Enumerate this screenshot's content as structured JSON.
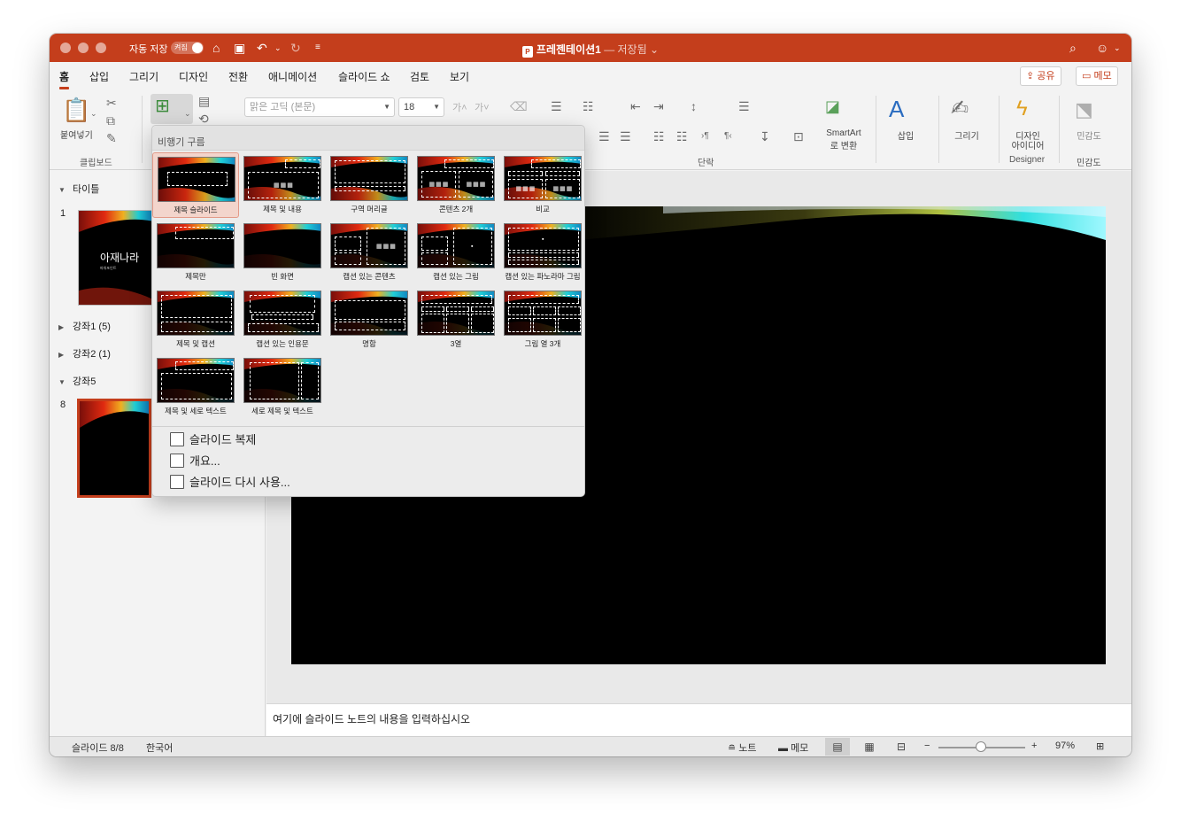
{
  "titlebar": {
    "autosave_label": "자동 저장",
    "autosave_state": "켜짐",
    "document_title": "프레젠테이션1",
    "save_status": "— 저장됨",
    "ppt_badge": "P"
  },
  "ribbon_tabs": [
    {
      "label": "홈",
      "active": true
    },
    {
      "label": "삽입"
    },
    {
      "label": "그리기"
    },
    {
      "label": "디자인"
    },
    {
      "label": "전환"
    },
    {
      "label": "애니메이션"
    },
    {
      "label": "슬라이드 쇼"
    },
    {
      "label": "검토"
    },
    {
      "label": "보기"
    }
  ],
  "share_button": "공유",
  "memo_button": "메모",
  "ribbon": {
    "paste_label": "붙여넣기",
    "clipboard_group": "클립보드",
    "font_name_placeholder": "맑은 고딕 (본문)",
    "font_size": "18",
    "paragraph_group": "단락",
    "smartart_label_1": "SmartArt",
    "smartart_label_2": "로 변환",
    "insert_label": "삽입",
    "draw_label": "그리기",
    "designer_label_1": "디자인",
    "designer_label_2": "아이디어",
    "designer_group": "Designer",
    "sensitivity_label": "민감도",
    "sensitivity_group": "민감도"
  },
  "layout_gallery": {
    "header": "비행기 구름",
    "layouts": [
      "제목 슬라이드",
      "제목 및 내용",
      "구역 머리글",
      "콘텐츠 2개",
      "비교",
      "제목만",
      "빈 화면",
      "캡션 있는 콘텐츠",
      "캡션 있는 그림",
      "캡션 있는 파노라마 그림",
      "제목 및 캡션",
      "캡션 있는 인용문",
      "명함",
      "3열",
      "그림 열 3개",
      "제목 및 세로 텍스트",
      "세로 제목 및 텍스트"
    ],
    "selected_index": 0,
    "commands": [
      "슬라이드 복제",
      "개요...",
      "슬라이드 다시 사용..."
    ]
  },
  "slide_pane": {
    "sections": [
      {
        "name": "타이틀",
        "expanded": true
      },
      {
        "name": "강좌1 (5)",
        "expanded": false
      },
      {
        "name": "강좌2 (1)",
        "expanded": false
      },
      {
        "name": "강좌5",
        "expanded": true
      }
    ],
    "slides": [
      {
        "number": "1",
        "title": "아재나라",
        "subtitle": "파워포인트"
      },
      {
        "number": "8",
        "selected": true
      }
    ]
  },
  "notes_placeholder": "여기에 슬라이드 노트의 내용을 입력하십시오",
  "status_bar": {
    "slide_indicator": "슬라이드 8/8",
    "language": "한국어",
    "notes_button": "노트",
    "comments_button": "메모",
    "zoom_level": "97%",
    "zoom_fraction": 0.47
  },
  "colors": {
    "accent": "#c43e1c",
    "titlebar": "#c43e1c",
    "slide_background": "#000000"
  }
}
